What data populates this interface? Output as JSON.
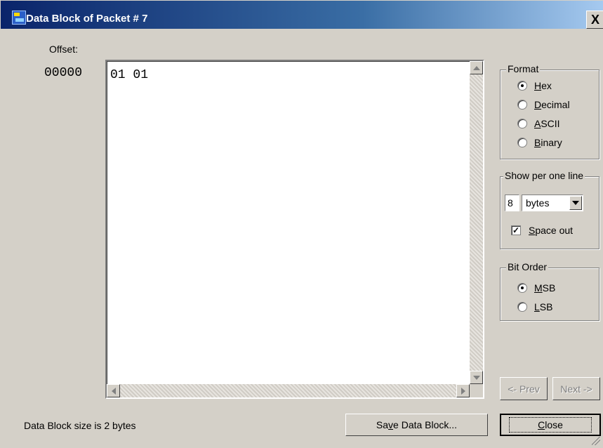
{
  "window": {
    "title": "Data Block of Packet # 7",
    "close_glyph": "X"
  },
  "offset": {
    "label": "Offset:",
    "value": "00000"
  },
  "data_block": {
    "text": "01 01"
  },
  "format_group": {
    "title": "Format",
    "options": [
      {
        "label_underline": "H",
        "label_rest": "ex",
        "checked": true
      },
      {
        "label_underline": "D",
        "label_rest": "ecimal",
        "checked": false
      },
      {
        "label_underline": "A",
        "label_rest": "SCII",
        "checked": false
      },
      {
        "label_underline": "B",
        "label_rest": "inary",
        "checked": false
      }
    ]
  },
  "per_line_group": {
    "title": "Show per one line",
    "count_value": "8",
    "unit_selected": "bytes",
    "space_out": {
      "label_underline": "S",
      "label_rest": "pace out",
      "checked": true
    }
  },
  "bit_order_group": {
    "title": "Bit Order",
    "options": [
      {
        "label_underline": "M",
        "label_rest": "SB",
        "checked": true
      },
      {
        "label_underline": "L",
        "label_rest": "SB",
        "checked": false
      }
    ]
  },
  "buttons": {
    "prev": "<- Prev",
    "next": "Next ->",
    "save_pre": "Sa",
    "save_underline": "v",
    "save_post": "e Data Block...",
    "close_underline": "C",
    "close_rest": "lose"
  },
  "status": {
    "text": "Data Block size is 2 bytes"
  }
}
